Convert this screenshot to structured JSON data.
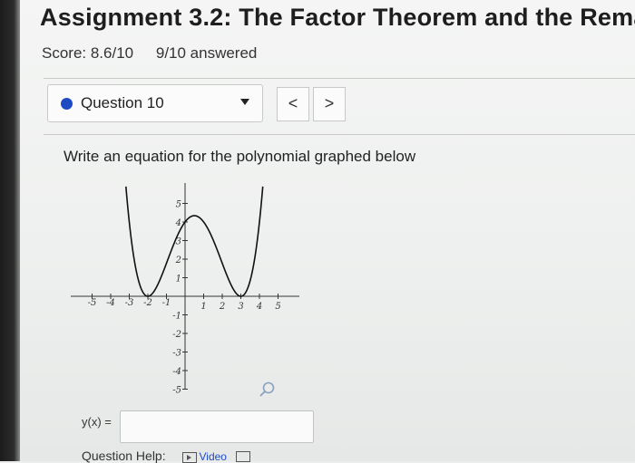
{
  "assignment": {
    "title": "Assignment 3.2: The Factor Theorem and the Rema",
    "score": "Score: 8.6/10",
    "answered": "9/10 answered"
  },
  "question_nav": {
    "current": "Question 10",
    "prev_label": "<",
    "next_label": ">",
    "status_color": "#1e4bc4"
  },
  "question": {
    "prompt": "Write an equation for the polynomial graphed below",
    "answer_label": "y(x) =",
    "answer_value": "",
    "help_label": "Question Help:",
    "video_label": "Video"
  },
  "graph": {
    "x_ticks": [
      "-5",
      "-4",
      "-3",
      "-2",
      "-1",
      "1",
      "2",
      "3",
      "4",
      "5"
    ],
    "y_ticks": [
      "5",
      "4",
      "3",
      "2",
      "1",
      "-1",
      "-2",
      "-3",
      "-4",
      "-5"
    ],
    "curve_color": "#111111",
    "zoom_icon": "magnifier-icon"
  }
}
